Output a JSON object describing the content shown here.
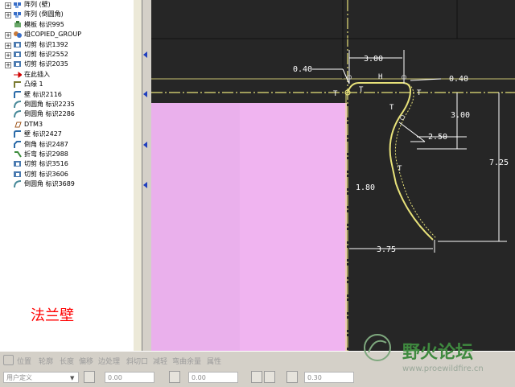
{
  "model_tree": {
    "items": [
      {
        "label": "阵列 (壁)",
        "icon": "pattern-icon",
        "expandable": true
      },
      {
        "label": "阵列 (倒圆角)",
        "icon": "pattern-icon",
        "expandable": true
      },
      {
        "label": "模板 标识995",
        "icon": "template-icon",
        "expandable": false
      },
      {
        "label": "组COPIED_GROUP",
        "icon": "group-icon",
        "expandable": true
      },
      {
        "label": "切剪 标识1392",
        "icon": "cut-icon",
        "expandable": true
      },
      {
        "label": "切剪 标识2552",
        "icon": "cut-icon",
        "expandable": true
      },
      {
        "label": "切剪 标识2035",
        "icon": "cut-icon",
        "expandable": true
      },
      {
        "label": "在此插入",
        "icon": "insert-here-arrow-icon",
        "expandable": false
      },
      {
        "label": "凸缘 1",
        "icon": "flange-icon",
        "expandable": false
      },
      {
        "label": "壁 标识2116",
        "icon": "wall-icon",
        "expandable": false
      },
      {
        "label": "倒圆角 标识2235",
        "icon": "round-icon",
        "expandable": false
      },
      {
        "label": "倒圆角 标识2286",
        "icon": "round-icon",
        "expandable": false
      },
      {
        "label": "DTM3",
        "icon": "datum-plane-icon",
        "expandable": false
      },
      {
        "label": "壁 标识2427",
        "icon": "wall-icon",
        "expandable": false
      },
      {
        "label": "倒角 标识2487",
        "icon": "chamfer-icon",
        "expandable": false
      },
      {
        "label": "折弯 标识2988",
        "icon": "bend-icon",
        "expandable": false
      },
      {
        "label": "切剪 标识3516",
        "icon": "cut-icon",
        "expandable": false
      },
      {
        "label": "切剪 标识3606",
        "icon": "cut-icon",
        "expandable": false
      },
      {
        "label": "倒圆角 标识3689",
        "icon": "round-icon",
        "expandable": false
      }
    ]
  },
  "annotation": {
    "label": "法兰壁",
    "color": "#ff0000"
  },
  "sketch": {
    "dimensions": [
      "3.00",
      "0.40",
      "0.40",
      "3.00",
      "2.50",
      "7.25",
      "1.80",
      "3.75"
    ],
    "constraint_labels": [
      "H",
      "T",
      "T",
      "T",
      "T",
      "T"
    ],
    "colors": {
      "background": "#262626",
      "profile": "#e8e27a",
      "dimension": "#ffffff",
      "surface": "#f0b4f0",
      "datum": "#e8e27a"
    }
  },
  "dashboard": {
    "tabs": [
      "位置",
      "轮廓",
      "长度",
      "偏移",
      "边处理",
      "斜切口",
      "减轻",
      "弯曲余量",
      "属性"
    ],
    "type_select": "用户定义",
    "length1": "0.00",
    "length2": "0.00",
    "radius": "0.30"
  },
  "watermark": {
    "title": "野火论坛",
    "url": "www.proewildfire.cn"
  }
}
